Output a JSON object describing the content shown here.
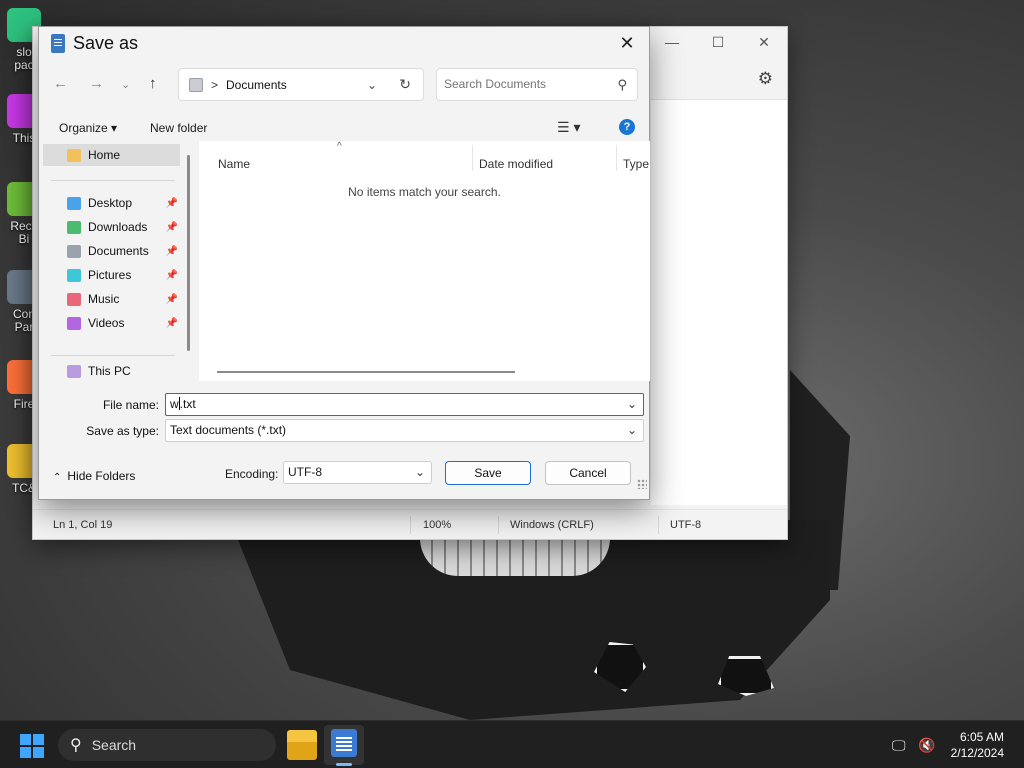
{
  "desktop": {
    "icons": [
      {
        "label": "slo\npac",
        "icon": "package-icon",
        "color": "#2ec27e"
      },
      {
        "label": "This",
        "icon": "monitor-icon",
        "color": "#c838e8"
      },
      {
        "label": "Recy\nBi",
        "icon": "recycle-bin-icon",
        "color": "#6fbf3a"
      },
      {
        "label": "Con\nPar",
        "icon": "gear-icon",
        "color": "#6b7a8a"
      },
      {
        "label": "Fire",
        "icon": "firefox-icon",
        "color": "#ff7139"
      },
      {
        "label": "TC&",
        "icon": "star-icon",
        "color": "#f2c230"
      }
    ]
  },
  "notepad": {
    "window_buttons": {
      "minimize": "—",
      "maximize": "☐",
      "close": "✕"
    },
    "status": {
      "position": "Ln 1, Col 19",
      "zoom": "100%",
      "line_endings": "Windows (CRLF)",
      "encoding": "UTF-8"
    }
  },
  "dialog": {
    "title": "Save as",
    "address": {
      "separator": ">",
      "location": "Documents"
    },
    "search": {
      "placeholder": "Search Documents"
    },
    "commands": {
      "organize": "Organize ▾",
      "new_folder": "New folder",
      "help": "?"
    },
    "nav_pane": {
      "home": "Home",
      "quick_access": [
        {
          "label": "Desktop",
          "color": "#4aa3e8"
        },
        {
          "label": "Downloads",
          "color": "#4cba6f"
        },
        {
          "label": "Documents",
          "color": "#9aa3ad"
        },
        {
          "label": "Pictures",
          "color": "#3fc7d9"
        },
        {
          "label": "Music",
          "color": "#e8677a"
        },
        {
          "label": "Videos",
          "color": "#b267e0"
        }
      ],
      "this_pc": "This PC"
    },
    "columns": [
      "Name",
      "Date modified",
      "Type"
    ],
    "empty_message": "No items match your search.",
    "file_name": {
      "label": "File name:",
      "value_before_cursor": "w",
      "value_after_cursor": ".txt"
    },
    "save_as_type": {
      "label": "Save as type:",
      "value": "Text documents (*.txt)"
    },
    "hide_folders": "Hide Folders",
    "encoding": {
      "label": "Encoding:",
      "value": "UTF-8"
    },
    "buttons": {
      "save": "Save",
      "cancel": "Cancel"
    }
  },
  "taskbar": {
    "search_label": "Search",
    "clock": {
      "time": "6:05 AM",
      "date": "2/12/2024"
    }
  }
}
